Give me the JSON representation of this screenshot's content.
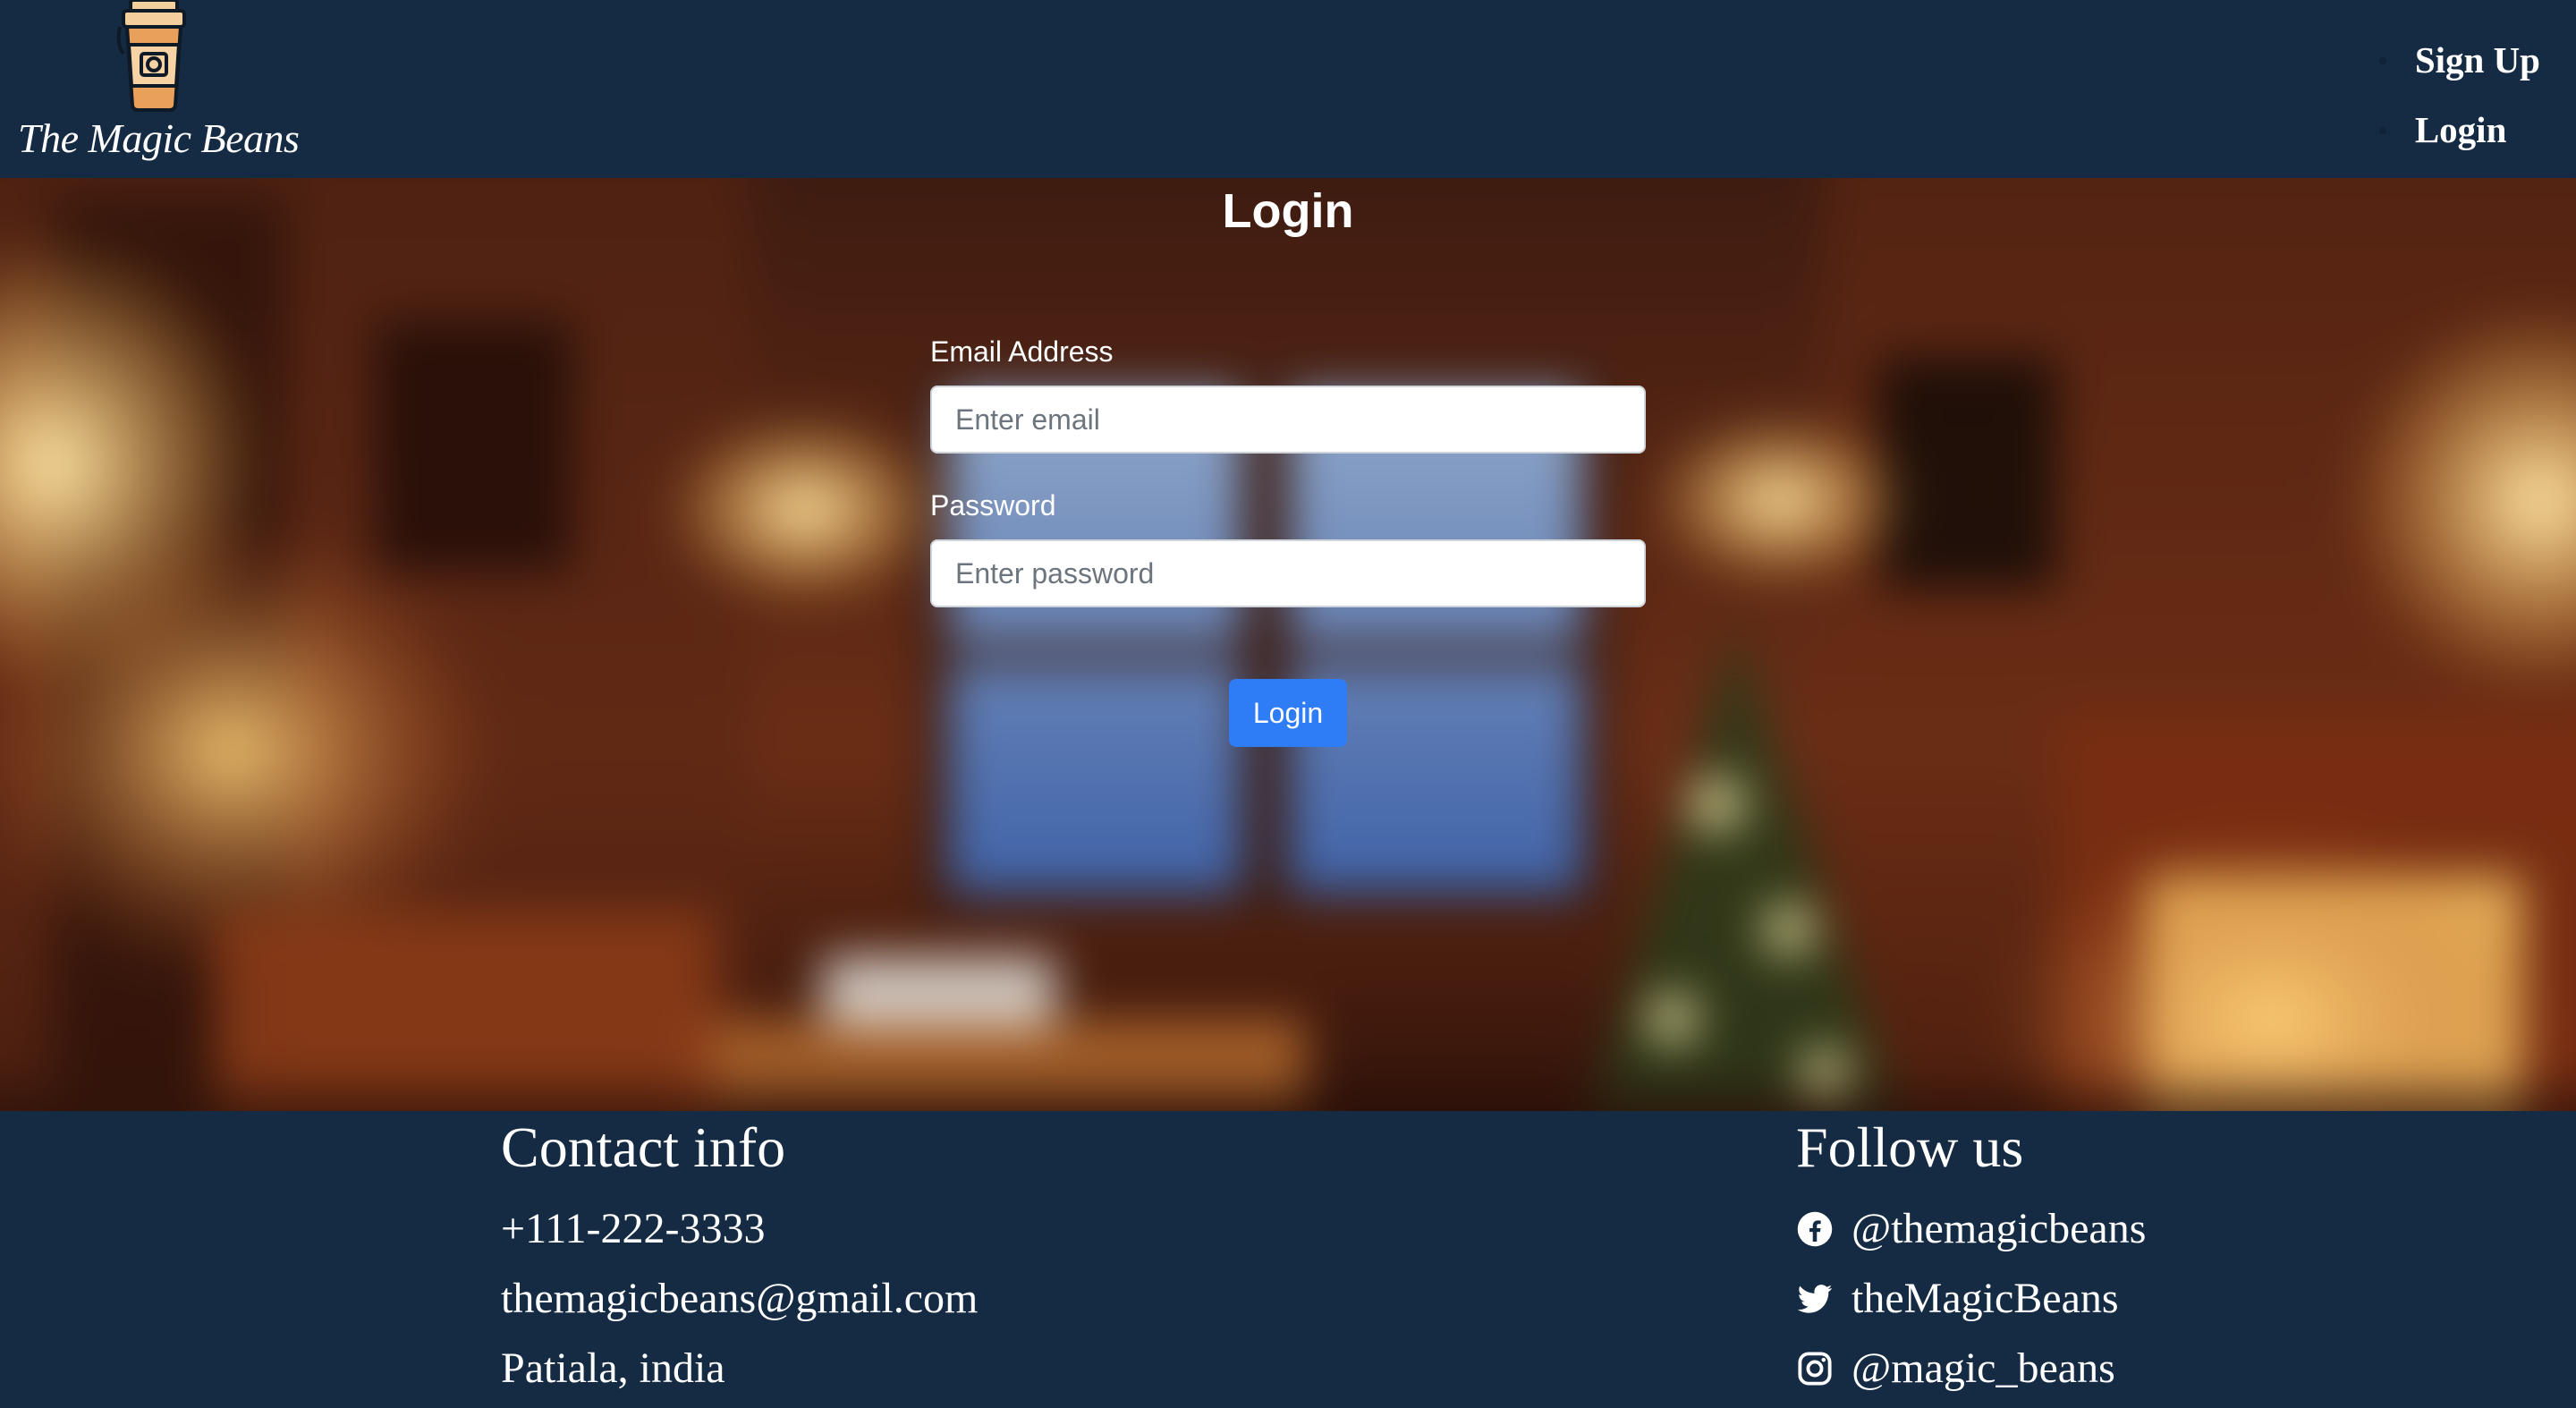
{
  "navbar": {
    "brand_name": "The Magic Beans",
    "brand_icon": "coffee-cup-icon",
    "links": [
      {
        "label": "Sign Up"
      },
      {
        "label": "Login"
      }
    ]
  },
  "login": {
    "title": "Login",
    "email_label": "Email Address",
    "email_placeholder": "Enter email",
    "email_value": "",
    "password_label": "Password",
    "password_placeholder": "Enter password",
    "password_value": "",
    "submit_label": "Login"
  },
  "footer": {
    "contact": {
      "heading": "Contact info",
      "phone": "+111-222-3333",
      "email": "themagicbeans@gmail.com",
      "address": "Patiala, india"
    },
    "follow": {
      "heading": "Follow us",
      "items": [
        {
          "icon": "facebook-icon",
          "handle": "@themagicbeans"
        },
        {
          "icon": "twitter-icon",
          "handle": "theMagicBeans"
        },
        {
          "icon": "instagram-icon",
          "handle": "@magic_beans"
        }
      ]
    }
  },
  "colors": {
    "navbar_bg": "#152b43",
    "primary_button": "#2f7df6",
    "text_light": "#ffffff"
  }
}
